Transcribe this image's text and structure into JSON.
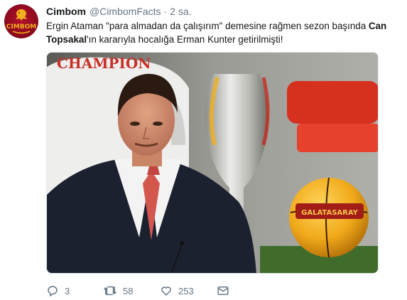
{
  "tweet": {
    "author_name": "Cimbom",
    "handle": "@CimbomFacts",
    "separator": "·",
    "time": "2 sa.",
    "avatar_text": "CIMBOM",
    "text_part1": "Ergin Ataman \"para almadan da çalışırım\" demesine rağmen sezon başında ",
    "text_bold": "Can Topsakal",
    "text_part2": "'ın kararıyla hocalığa Erman Kunter getirilmişti!",
    "image": {
      "shirt_text": "CHAMPION",
      "ball_text": "GALATASARAY"
    },
    "actions": {
      "reply_icon": "reply-icon",
      "reply_count": "3",
      "retweet_icon": "retweet-icon",
      "retweet_count": "58",
      "like_icon": "heart-icon",
      "like_count": "253",
      "dm_icon": "envelope-icon"
    },
    "colors": {
      "link": "#1da1f2",
      "muted": "#657786",
      "brand": "#a90f26",
      "brand_gold": "#f2b01e"
    }
  }
}
